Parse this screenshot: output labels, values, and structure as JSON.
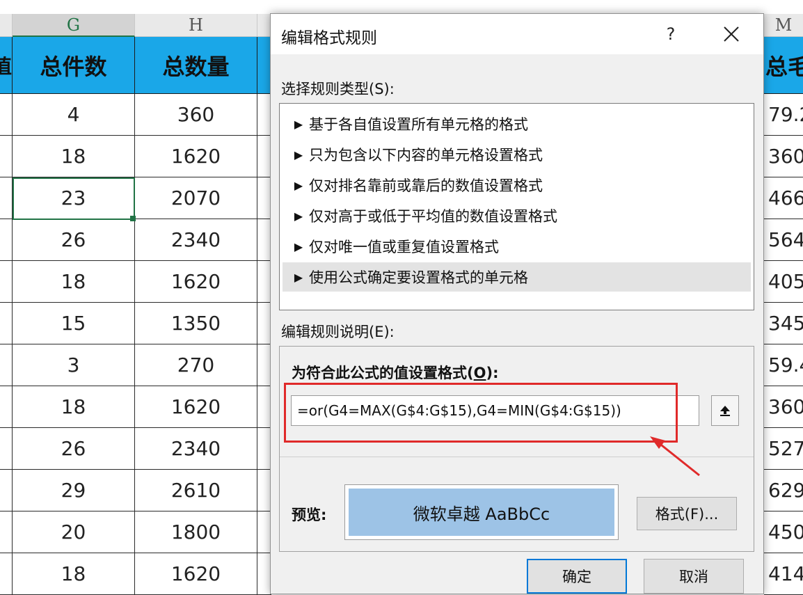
{
  "sheet": {
    "col_headers": {
      "G": "G",
      "H": "H",
      "M": "M"
    },
    "headers": {
      "left_partial": "值",
      "G": "总件数",
      "H": "总数量",
      "right_partial": "总毛重"
    },
    "rows": [
      {
        "g": "4",
        "h": "360",
        "m": "79.2"
      },
      {
        "g": "18",
        "h": "1620",
        "m": "360"
      },
      {
        "g": "23",
        "h": "2070",
        "m": "466."
      },
      {
        "g": "26",
        "h": "2340",
        "m": "564."
      },
      {
        "g": "18",
        "h": "1620",
        "m": "405"
      },
      {
        "g": "15",
        "h": "1350",
        "m": "345"
      },
      {
        "g": "3",
        "h": "270",
        "m": "59.4"
      },
      {
        "g": "18",
        "h": "1620",
        "m": "360"
      },
      {
        "g": "26",
        "h": "2340",
        "m": "527."
      },
      {
        "g": "29",
        "h": "2610",
        "m": "629."
      },
      {
        "g": "20",
        "h": "1800",
        "m": "450"
      },
      {
        "g": "18",
        "h": "1620",
        "m": "414"
      }
    ]
  },
  "dialog": {
    "title": "编辑格式规则",
    "help": "?",
    "select_type_label": "选择规则类型(S):",
    "rule_types": [
      "基于各自值设置所有单元格的格式",
      "只为包含以下内容的单元格设置格式",
      "仅对排名靠前或靠后的数值设置格式",
      "仅对高于或低于平均值的数值设置格式",
      "仅对唯一值或重复值设置格式",
      "使用公式确定要设置格式的单元格"
    ],
    "selected_rule_index": 5,
    "edit_desc_label": "编辑规则说明(E):",
    "formula_label_pre": "为符合此公式的值设置格式(",
    "formula_label_key": "O",
    "formula_label_post": "):",
    "formula_value": "=or(G4=MAX(G$4:G$15),G4=MIN(G$4:G$15))",
    "preview_label": "预览:",
    "preview_text": "微软卓越  AaBbCc",
    "preview_fill": "#9dc3e6",
    "format_button": "格式(F)...",
    "ok_button": "确定",
    "cancel_button": "取消"
  },
  "colors": {
    "header_fill": "#1aa7e8",
    "highlight": "#e02a2a",
    "selection": "#217346"
  }
}
